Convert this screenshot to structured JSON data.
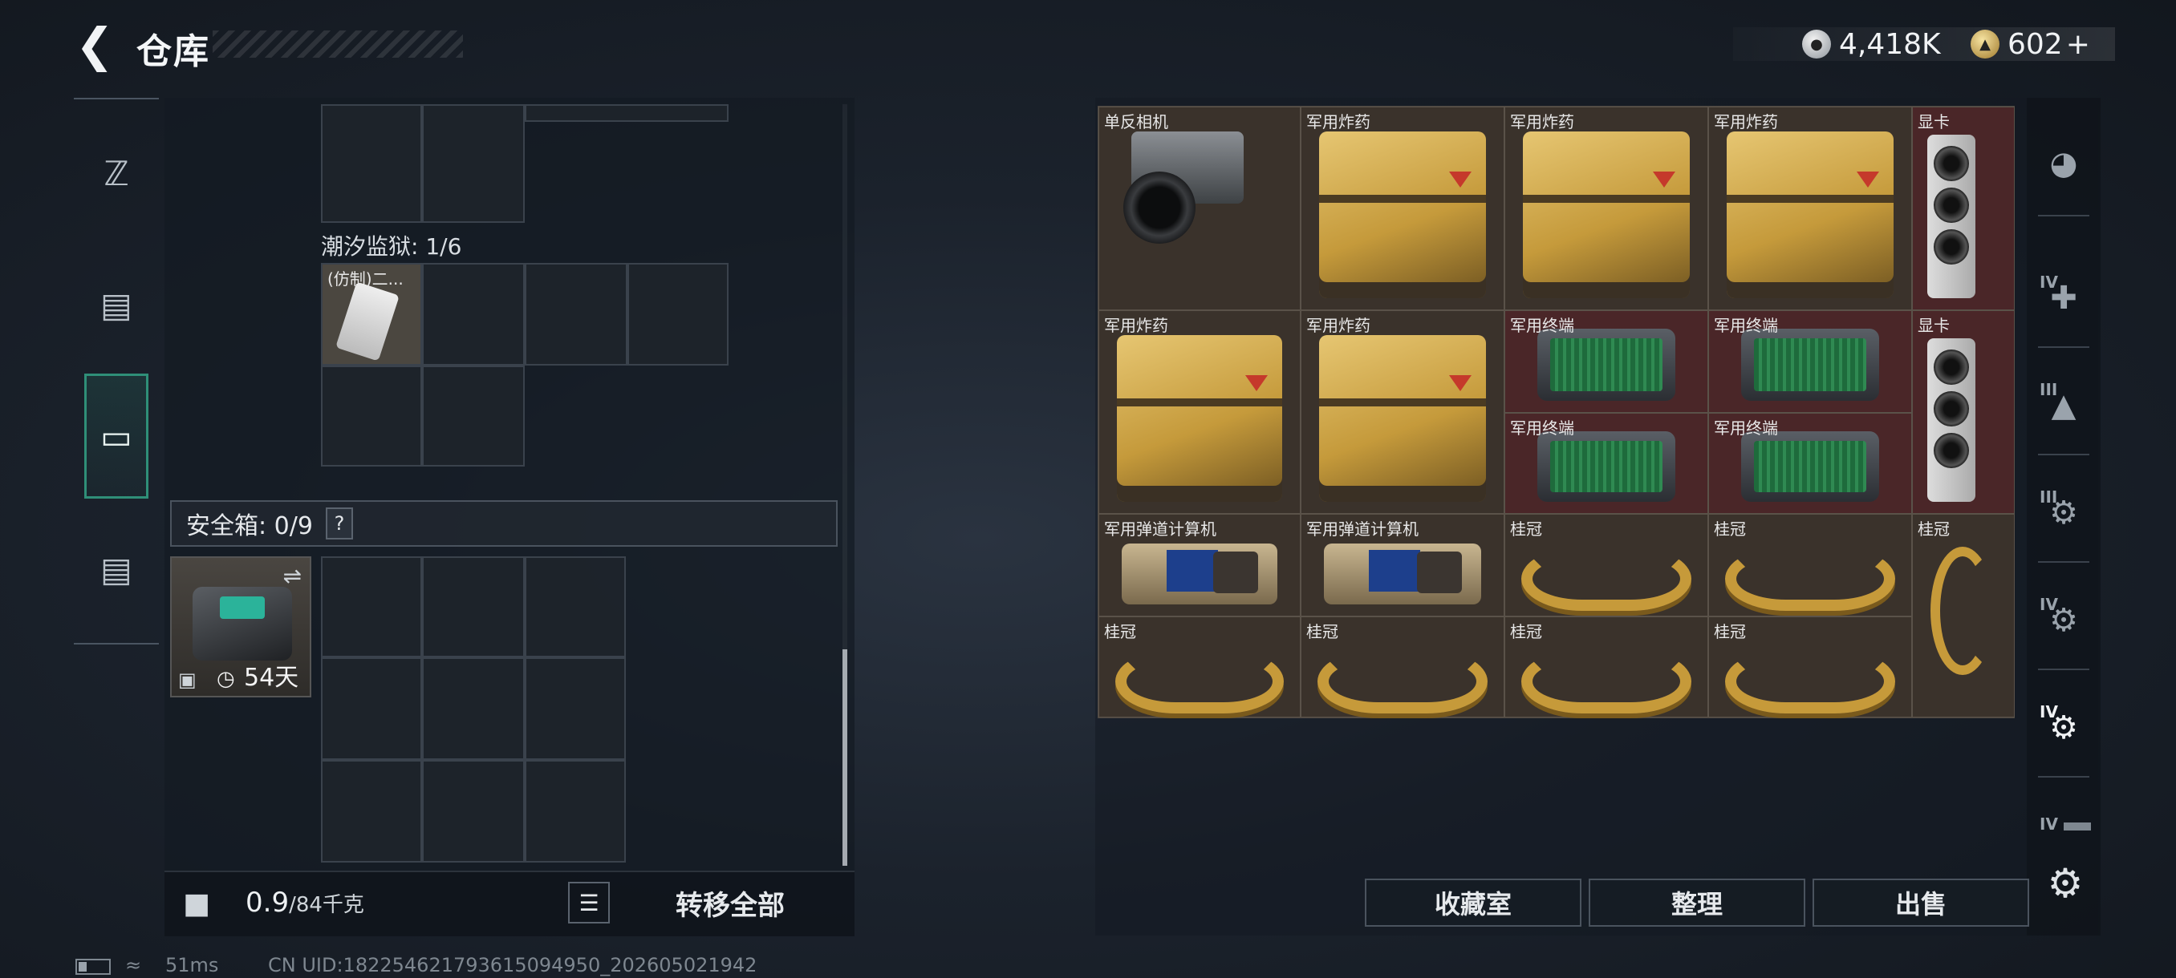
{
  "header": {
    "title": "仓库",
    "currency": [
      {
        "icon": "silver-coin-icon",
        "value": "4,418K"
      },
      {
        "icon": "gold-coin-icon",
        "value": "602",
        "suffix": "+"
      }
    ]
  },
  "left_tabs": [
    {
      "name": "weapon",
      "icon": "pistol-icon",
      "active": false
    },
    {
      "name": "armor",
      "icon": "vest-icon",
      "active": false
    },
    {
      "name": "backpack",
      "icon": "backpack-icon",
      "active": true
    },
    {
      "name": "kit",
      "icon": "toolbox-icon",
      "active": false
    }
  ],
  "containers": {
    "tide_prison_label": "潮汐监狱: 1/6",
    "tide_item_name": "(仿制)二...",
    "safebox_label": "安全箱: 0/9",
    "safebox_help": "?",
    "safebox_days": "54天"
  },
  "bottom": {
    "weight_value": "0.9",
    "weight_capacity": "/84千克",
    "list_icon": "list-icon",
    "transfer_all": "转移全部"
  },
  "stash_items": [
    {
      "name": "单反相机",
      "kind": "camera"
    },
    {
      "name": "军用炸药",
      "kind": "crate"
    },
    {
      "name": "军用炸药",
      "kind": "crate"
    },
    {
      "name": "军用炸药",
      "kind": "crate"
    },
    {
      "name": "显卡",
      "kind": "gpu"
    },
    {
      "name": "军用炸药",
      "kind": "crate"
    },
    {
      "name": "军用炸药",
      "kind": "crate"
    },
    {
      "name": "军用终端",
      "kind": "terminal"
    },
    {
      "name": "军用终端",
      "kind": "terminal"
    },
    {
      "name": "显卡",
      "kind": "gpu"
    },
    {
      "name": "军用终端",
      "kind": "terminal"
    },
    {
      "name": "军用终端",
      "kind": "terminal"
    },
    {
      "name": "军用弹道计算机",
      "kind": "ballistic"
    },
    {
      "name": "军用弹道计算机",
      "kind": "ballistic"
    },
    {
      "name": "桂冠",
      "kind": "laurel"
    },
    {
      "name": "桂冠",
      "kind": "laurel"
    },
    {
      "name": "桂冠",
      "kind": "laurel"
    },
    {
      "name": "桂冠",
      "kind": "laurel"
    },
    {
      "name": "桂冠",
      "kind": "laurel"
    },
    {
      "name": "桂冠",
      "kind": "laurel"
    },
    {
      "name": "桂冠",
      "kind": "laurel"
    }
  ],
  "right_rail": [
    {
      "icon": "helmet-icon",
      "label": ""
    },
    {
      "icon": "plus-case-icon",
      "label": "IV"
    },
    {
      "icon": "ammo-box-icon",
      "label": "III"
    },
    {
      "icon": "tool-case-icon",
      "label": "III"
    },
    {
      "icon": "gear-case-icon",
      "label": "IV"
    },
    {
      "icon": "key-case-icon",
      "label": "IV"
    },
    {
      "icon": "card-case-icon",
      "label": "IV"
    }
  ],
  "actions": {
    "collection": "收藏室",
    "sort": "整理",
    "sell": "出售"
  },
  "status": {
    "ping": "51ms",
    "uid": "CN UID:182254621793615094950_202605021942"
  }
}
